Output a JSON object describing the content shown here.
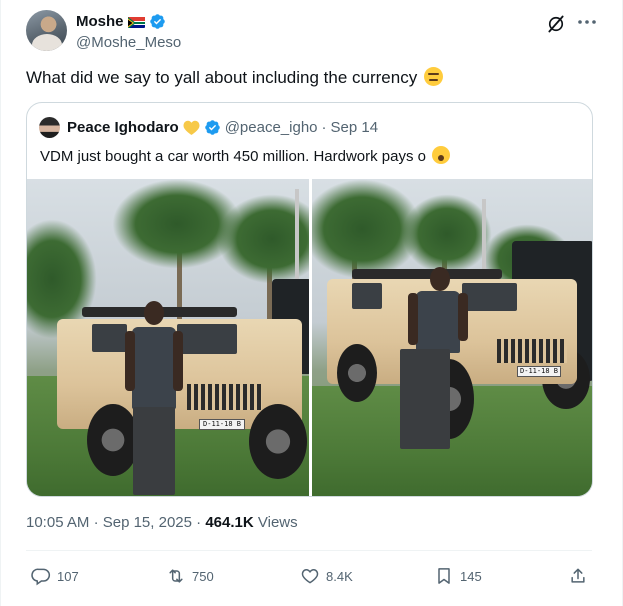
{
  "author": {
    "name": "Moshe",
    "handle": "@Moshe_Meso"
  },
  "tweet": {
    "text": "What did we say to yall about including the currency"
  },
  "quote": {
    "name": "Peace Ighodaro",
    "handle": "@peace_igho",
    "separator": "·",
    "date": "Sep 14",
    "text": "VDM just bought a car worth 450 million. Hardwork pays o",
    "plate_text": "D-11-18 B"
  },
  "meta": {
    "time": "10:05 AM",
    "sep1": "·",
    "date": "Sep 15, 2025",
    "sep2": "·",
    "views_count": "464.1K",
    "views_label": "Views"
  },
  "actions": {
    "replies": "107",
    "reposts": "750",
    "likes": "8.4K",
    "bookmarks": "145"
  },
  "colors": {
    "verified": "#1d9bf0",
    "secondary_text": "#536471",
    "border": "#cfd9de",
    "heart_emoji": "#f7c948"
  },
  "icons": [
    "verified-badge-icon",
    "south-africa-flag-icon",
    "grok-icon",
    "more-icon",
    "yellow-heart-icon",
    "reply-icon",
    "repost-icon",
    "like-icon",
    "bookmark-icon",
    "share-icon"
  ]
}
